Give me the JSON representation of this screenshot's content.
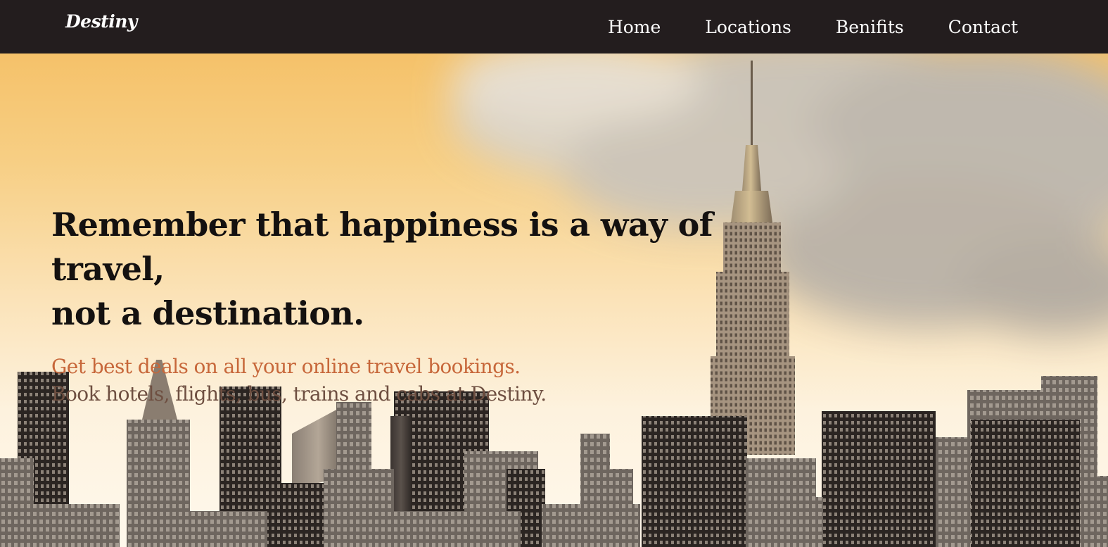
{
  "navbar": {
    "brand": "Destiny",
    "links": [
      {
        "label": "Home"
      },
      {
        "label": "Locations"
      },
      {
        "label": "Benifits"
      },
      {
        "label": "Contact"
      }
    ],
    "background_color": "#231d1e"
  },
  "hero": {
    "headline_line1": "Remember that happiness is a way of travel,",
    "headline_line2": "not a destination.",
    "tagline": "Get best deals on all your online travel bookings.",
    "subline": "Book hotels, flights, bus, trains and cabs at Destiny.",
    "tagline_color": "#c7673a",
    "subline_color": "#6e4f41",
    "background_image": "city-skyline-with-clouds"
  }
}
